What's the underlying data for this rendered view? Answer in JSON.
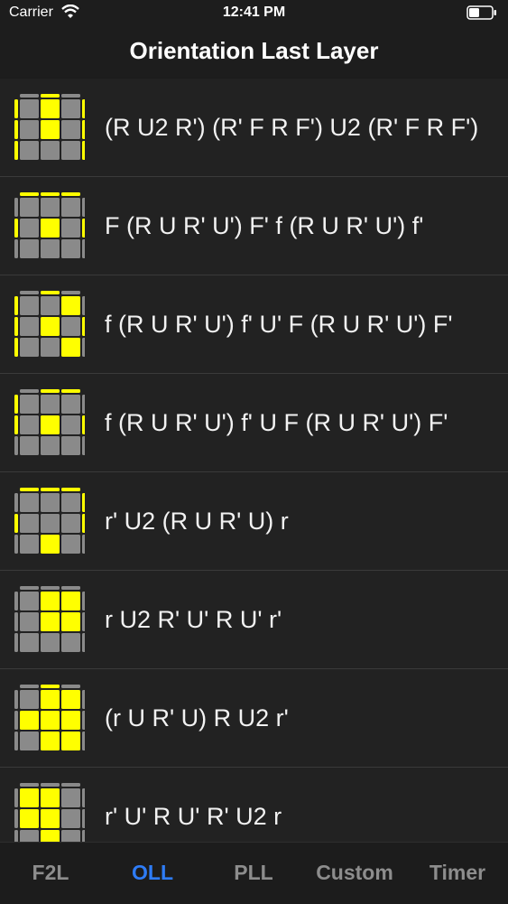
{
  "status": {
    "carrier": "Carrier",
    "time": "12:41 PM"
  },
  "nav": {
    "title": "Orientation Last Layer"
  },
  "colors": {
    "yellow": "#ffff00",
    "gray": "#8a8a8a",
    "accent": "#2e7cf6"
  },
  "algorithms": [
    {
      "alg": "(R U2 R') (R' F R F') U2 (R' F R F')",
      "pattern": {
        "grid": [
          [
            0,
            1,
            0
          ],
          [
            0,
            1,
            0
          ],
          [
            0,
            0,
            0
          ]
        ],
        "top": [
          0,
          1,
          0
        ],
        "bottom": [
          0,
          1,
          0
        ],
        "left": [
          1,
          1,
          1
        ],
        "right": [
          1,
          1,
          1
        ]
      }
    },
    {
      "alg": "F (R U R' U') F' f (R U R' U') f'",
      "pattern": {
        "grid": [
          [
            0,
            0,
            0
          ],
          [
            0,
            1,
            0
          ],
          [
            0,
            0,
            0
          ]
        ],
        "top": [
          1,
          1,
          1
        ],
        "bottom": [
          1,
          1,
          1
        ],
        "left": [
          0,
          1,
          0
        ],
        "right": [
          0,
          1,
          0
        ]
      }
    },
    {
      "alg": "f (R U R' U') f' U' F (R U R' U') F'",
      "pattern": {
        "grid": [
          [
            0,
            0,
            1
          ],
          [
            0,
            1,
            0
          ],
          [
            0,
            0,
            1
          ]
        ],
        "top": [
          0,
          1,
          0
        ],
        "bottom": [
          0,
          1,
          0
        ],
        "left": [
          1,
          1,
          1
        ],
        "right": [
          0,
          1,
          0
        ]
      }
    },
    {
      "alg": "f (R U R' U') f' U F (R U R' U') F'",
      "pattern": {
        "grid": [
          [
            0,
            0,
            0
          ],
          [
            0,
            1,
            0
          ],
          [
            0,
            0,
            0
          ]
        ],
        "top": [
          0,
          1,
          1
        ],
        "bottom": [
          0,
          1,
          0
        ],
        "left": [
          1,
          1,
          0
        ],
        "right": [
          0,
          1,
          0
        ]
      }
    },
    {
      "alg": "r' U2 (R U R' U) r",
      "pattern": {
        "grid": [
          [
            0,
            0,
            0
          ],
          [
            0,
            0,
            0
          ],
          [
            0,
            1,
            0
          ]
        ],
        "top": [
          1,
          1,
          1
        ],
        "bottom": [
          0,
          0,
          0
        ],
        "left": [
          0,
          1,
          0
        ],
        "right": [
          1,
          1,
          0
        ]
      }
    },
    {
      "alg": "r U2 R' U' R U' r'",
      "pattern": {
        "grid": [
          [
            0,
            1,
            1
          ],
          [
            0,
            1,
            1
          ],
          [
            0,
            0,
            0
          ]
        ],
        "top": [
          0,
          0,
          0
        ],
        "bottom": [
          1,
          1,
          1
        ],
        "left": [
          0,
          0,
          0
        ],
        "right": [
          0,
          0,
          0
        ]
      }
    },
    {
      "alg": "(r U R' U) R U2 r'",
      "pattern": {
        "grid": [
          [
            0,
            1,
            1
          ],
          [
            1,
            1,
            1
          ],
          [
            0,
            1,
            1
          ]
        ],
        "top": [
          0,
          1,
          0
        ],
        "bottom": [
          0,
          1,
          0
        ],
        "left": [
          0,
          0,
          0
        ],
        "right": [
          0,
          0,
          0
        ]
      }
    },
    {
      "alg": "r' U' R U' R' U2 r",
      "pattern": {
        "grid": [
          [
            1,
            1,
            0
          ],
          [
            1,
            1,
            0
          ],
          [
            0,
            1,
            0
          ]
        ],
        "top": [
          0,
          0,
          0
        ],
        "bottom": [
          0,
          0,
          0
        ],
        "left": [
          0,
          0,
          0
        ],
        "right": [
          0,
          0,
          0
        ]
      }
    }
  ],
  "tabs": [
    {
      "label": "F2L",
      "active": false
    },
    {
      "label": "OLL",
      "active": true
    },
    {
      "label": "PLL",
      "active": false
    },
    {
      "label": "Custom",
      "active": false
    },
    {
      "label": "Timer",
      "active": false
    }
  ]
}
